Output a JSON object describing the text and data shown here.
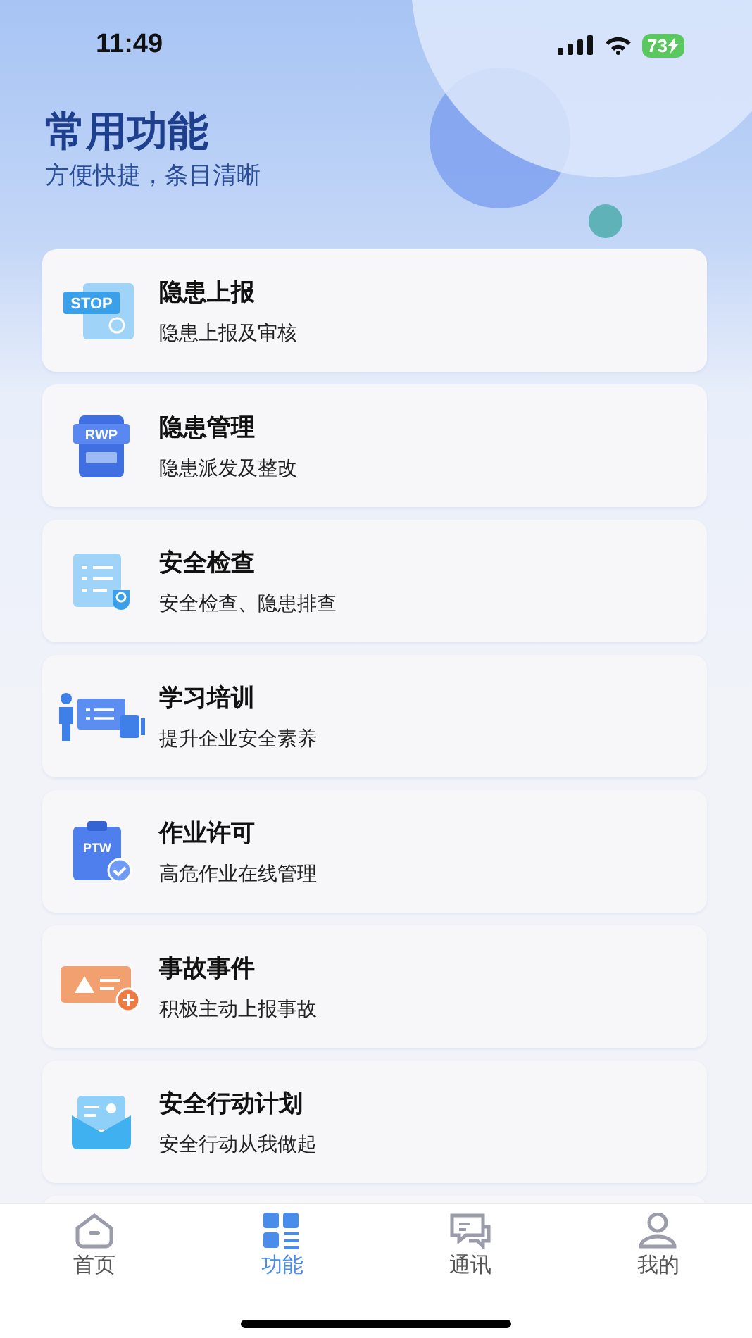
{
  "status_bar": {
    "time": "11:49",
    "battery": "73"
  },
  "header": {
    "title": "常用功能",
    "subtitle": "方便快捷，条目清晰"
  },
  "items": [
    {
      "kind": "stop",
      "icon_text": "STOP",
      "title": "隐患上报",
      "desc": "隐患上报及审核"
    },
    {
      "kind": "rwp",
      "icon_text": "RWP",
      "title": "隐患管理",
      "desc": "隐患派发及整改"
    },
    {
      "kind": "checklist",
      "title": "安全检查",
      "desc": "安全检查、隐患排查"
    },
    {
      "kind": "training",
      "title": "学习培训",
      "desc": "提升企业安全素养"
    },
    {
      "kind": "ptw",
      "icon_text": "PTW",
      "title": "作业许可",
      "desc": "高危作业在线管理"
    },
    {
      "kind": "accident",
      "title": "事故事件",
      "desc": "积极主动上报事故"
    },
    {
      "kind": "envelope",
      "title": "安全行动计划",
      "desc": "安全行动从我做起"
    }
  ],
  "tabs": [
    {
      "kind": "home",
      "label": "首页",
      "selected": false
    },
    {
      "kind": "grid",
      "label": "功能",
      "selected": true
    },
    {
      "kind": "chat",
      "label": "通讯",
      "selected": false
    },
    {
      "kind": "user",
      "label": "我的",
      "selected": false
    }
  ]
}
